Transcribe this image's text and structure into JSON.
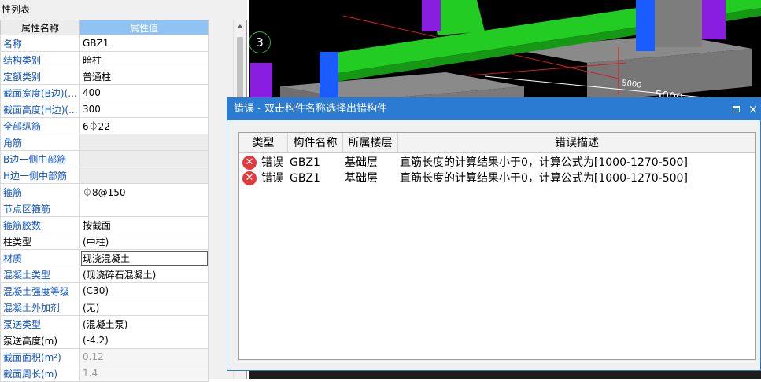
{
  "panel": {
    "title": "性列表",
    "header_name": "属性名称",
    "header_value": "属性值",
    "rows": [
      {
        "name": "名称",
        "value": "GBZ1"
      },
      {
        "name": "结构类别",
        "value": "暗柱"
      },
      {
        "name": "定额类别",
        "value": "普通柱"
      },
      {
        "name": "截面宽度(B边)(...",
        "value": "400"
      },
      {
        "name": "截面高度(H边)(...",
        "value": "300"
      },
      {
        "name": "全部纵筋",
        "value": "6⏀22"
      },
      {
        "name": "角筋",
        "value": ""
      },
      {
        "name": "B边一侧中部筋",
        "value": ""
      },
      {
        "name": "H边一侧中部筋",
        "value": ""
      },
      {
        "name": "箍筋",
        "value": "⏀8@150"
      },
      {
        "name": "节点区箍筋",
        "value": ""
      },
      {
        "name": "箍筋胶数",
        "value": "按截面"
      },
      {
        "name": "柱类型",
        "value": "(中柱)"
      },
      {
        "name": "材质",
        "value": "现浇混凝土"
      },
      {
        "name": "混凝土类型",
        "value": "(现浇碎石混凝土)"
      },
      {
        "name": "混凝土强度等级",
        "value": "(C30)"
      },
      {
        "name": "混凝土外加剂",
        "value": "(无)"
      },
      {
        "name": "泵送类型",
        "value": "(混凝土泵)"
      },
      {
        "name": "泵送高度(m)",
        "value": "(-4.2)"
      },
      {
        "name": "截面面积(m²)",
        "value": "0.12"
      },
      {
        "name": "截面周长(m)",
        "value": "1.4"
      }
    ]
  },
  "viewport": {
    "floor_number": "3",
    "dim_label_1": "5000",
    "dim_label_2": "5000"
  },
  "dialog": {
    "title": "错误 - 双击构件名称选择出错构件",
    "maximize_icon": "maximize-icon",
    "close_label": "×",
    "columns": [
      "类型",
      "构件名称",
      "所属楼层",
      "错误描述"
    ],
    "rows": [
      {
        "type": "错误",
        "component": "GBZ1",
        "floor": "基础层",
        "description": "直筋长度的计算结果小于0，计算公式为[1000-1270-500]"
      },
      {
        "type": "错误",
        "component": "GBZ1",
        "floor": "基础层",
        "description": "直筋长度的计算结果小于0，计算公式为[1000-1270-500]"
      }
    ]
  },
  "colors": {
    "title_bar": "#2b7bd3",
    "header_value_bg": "#8fc3f4",
    "link_blue": "#1155cc",
    "error_red": "#e23a3a",
    "beam_green": "#22cc22",
    "column_purple": "#8a1ee0",
    "column_blue": "#1a5cff"
  }
}
